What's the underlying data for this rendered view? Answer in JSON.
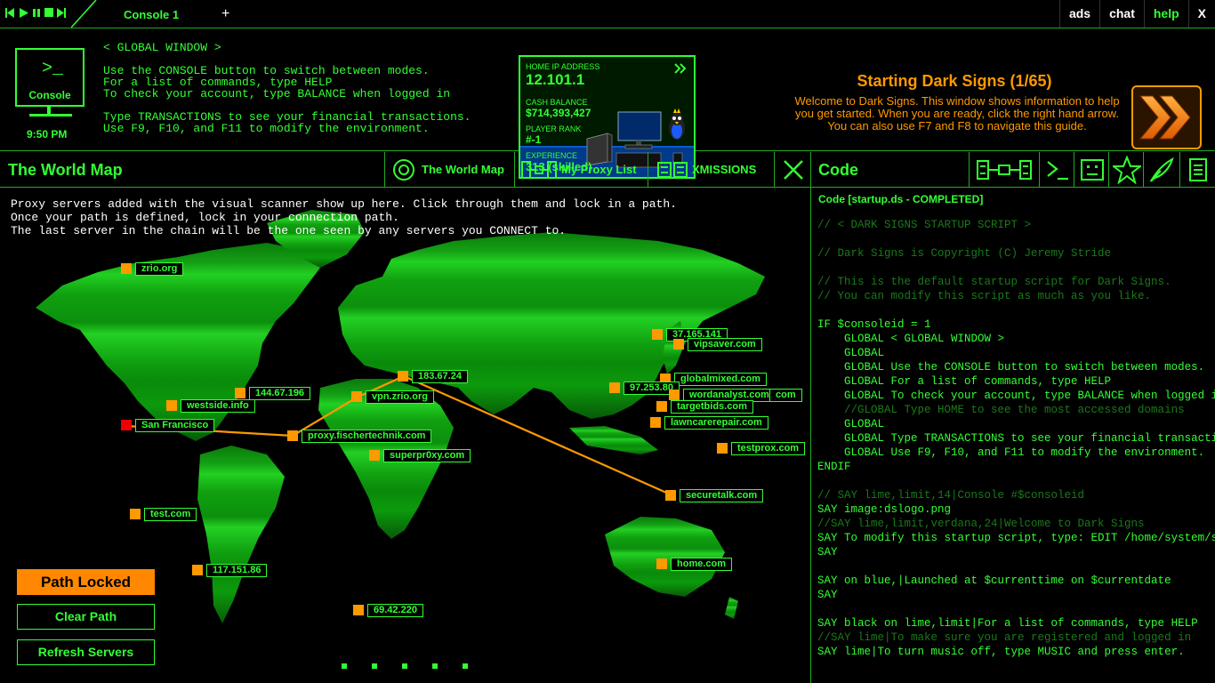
{
  "topbar": {
    "media_controls": [
      "skip-back",
      "play",
      "pause",
      "stop",
      "skip-forward"
    ],
    "tab_label": "Console 1",
    "add_tab": "+",
    "right_items": [
      {
        "label": "ads",
        "accent": false
      },
      {
        "label": "chat",
        "accent": false
      },
      {
        "label": "help",
        "accent": true
      },
      {
        "label": "X",
        "accent": false
      }
    ]
  },
  "console": {
    "prompt_glyph": ">_",
    "label": "Console",
    "time": "9:50 PM",
    "window_text": "< GLOBAL WINDOW >\n\nUse the CONSOLE button to switch between modes.\nFor a list of commands, type HELP\nTo check your account, type BALANCE when logged in\n\nType TRANSACTIONS to see your financial transactions.\nUse F9, F10, and F11 to modify the environment."
  },
  "player": {
    "home_ip_label": "HOME IP ADDRESS",
    "home_ip": "12.101.1",
    "cash_label": "CASH BALANCE",
    "cash": "$714,393,427",
    "rank_label": "PLAYER RANK",
    "rank": "#-1",
    "exp_label": "EXPERIENCE",
    "exp": "313 (skilled)"
  },
  "guide": {
    "title": "Starting Dark Signs (1/65)",
    "text": "Welcome to Dark Signs. This window shows information to help you get started. When you are ready, click the right hand arrow. You can also use F7 and F8 to navigate this guide."
  },
  "worldmap": {
    "title": "The World Map",
    "tabs": [
      {
        "label": "The World Map",
        "icon": "target-icon"
      },
      {
        "label": "My Proxy List",
        "icon": "proxy-chain-icon"
      },
      {
        "label": "XMISSIONS",
        "icon": "mission-icon"
      }
    ],
    "close": "close-icon",
    "intro": "Proxy servers added with the visual scanner show up here. Click through them and lock in a path.\nOnce your path is defined, lock in your connection path.\nThe last server in the chain will be the one seen by any servers you CONNECT to.",
    "nodes": [
      {
        "label": "zrio.org",
        "origin": false
      },
      {
        "label": "144.67.196",
        "origin": false
      },
      {
        "label": "westside.info",
        "origin": false
      },
      {
        "label": "San Francisco",
        "origin": true
      },
      {
        "label": "proxy.fischertechnik.com",
        "origin": false
      },
      {
        "label": "vpn.zrio.org",
        "origin": false
      },
      {
        "label": "183.67.24",
        "origin": false
      },
      {
        "label": "superpr0xy.com",
        "origin": false
      },
      {
        "label": "test.com",
        "origin": false
      },
      {
        "label": "117.151.86",
        "origin": false
      },
      {
        "label": "69.42.220",
        "origin": false
      },
      {
        "label": "37.165.141",
        "origin": false
      },
      {
        "label": "vipsaver.com",
        "origin": false
      },
      {
        "label": "globalmixed.com",
        "origin": false
      },
      {
        "label": "97.253.80",
        "origin": false
      },
      {
        "label": "wordanalyst.com",
        "origin": false
      },
      {
        "label": "com",
        "origin": false
      },
      {
        "label": "targetbids.com",
        "origin": false
      },
      {
        "label": "lawncarerepair.com",
        "origin": false
      },
      {
        "label": "testprox.com",
        "origin": false
      },
      {
        "label": "securetalk.com",
        "origin": false
      },
      {
        "label": "home.com",
        "origin": false
      }
    ],
    "buttons": {
      "locked": "Path Locked",
      "clear": "Clear Path",
      "refresh": "Refresh Servers"
    }
  },
  "code": {
    "title": "Code",
    "tools": [
      "network-icon",
      "terminal-icon",
      "face-icon",
      "star-icon",
      "feather-icon",
      "document-icon"
    ],
    "status": "Code [startup.ds - COMPLETED]",
    "lines": [
      {
        "text": "// < DARK SIGNS STARTUP SCRIPT >",
        "comment": true
      },
      {
        "text": "",
        "comment": true
      },
      {
        "text": "// Dark Signs is Copyright (C) Jeremy Stride",
        "comment": true
      },
      {
        "text": "",
        "comment": true
      },
      {
        "text": "// This is the default startup script for Dark Signs.",
        "comment": true
      },
      {
        "text": "// You can modify this script as much as you like.",
        "comment": true
      },
      {
        "text": "",
        "comment": true
      },
      {
        "text": "IF $consoleid = 1",
        "comment": false
      },
      {
        "text": "    GLOBAL < GLOBAL WINDOW >",
        "comment": false
      },
      {
        "text": "    GLOBAL",
        "comment": false
      },
      {
        "text": "    GLOBAL Use the CONSOLE button to switch between modes.",
        "comment": false
      },
      {
        "text": "    GLOBAL For a list of commands, type HELP",
        "comment": false
      },
      {
        "text": "    GLOBAL To check your account, type BALANCE when logged in",
        "comment": false
      },
      {
        "text": "    //GLOBAL Type HOME to see the most accessed domains",
        "comment": true
      },
      {
        "text": "    GLOBAL",
        "comment": false
      },
      {
        "text": "    GLOBAL Type TRANSACTIONS to see your financial transactions.",
        "comment": false
      },
      {
        "text": "    GLOBAL Use F9, F10, and F11 to modify the environment.",
        "comment": false
      },
      {
        "text": "ENDIF",
        "comment": false
      },
      {
        "text": "",
        "comment": true
      },
      {
        "text": "// SAY lime,limit,14|Console #$consoleid",
        "comment": true
      },
      {
        "text": "SAY image:dslogo.png",
        "comment": false
      },
      {
        "text": "//SAY lime,limit,verdana,24|Welcome to Dark Signs",
        "comment": true
      },
      {
        "text": "SAY To modify this startup script, type: EDIT /home/system/startup.ds",
        "comment": false
      },
      {
        "text": "SAY",
        "comment": false
      },
      {
        "text": "",
        "comment": true
      },
      {
        "text": "SAY on blue,|Launched at $currenttime on $currentdate",
        "comment": false
      },
      {
        "text": "SAY",
        "comment": false
      },
      {
        "text": "",
        "comment": true
      },
      {
        "text": "SAY black on lime,limit|For a list of commands, type HELP",
        "comment": false
      },
      {
        "text": "//SAY lime|To make sure you are registered and logged in",
        "comment": true
      },
      {
        "text": "SAY lime|To turn music off, type MUSIC and press enter.",
        "comment": false
      }
    ]
  }
}
